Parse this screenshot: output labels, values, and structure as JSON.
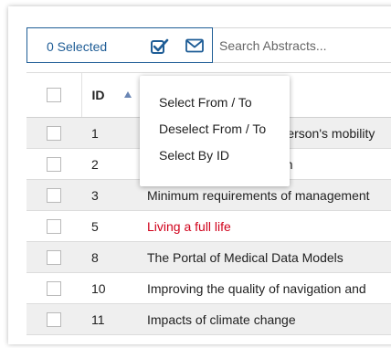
{
  "toolbar": {
    "selected_label": "0 Selected",
    "icons": [
      "checkbox-icon",
      "envelope-icon"
    ],
    "search": {
      "placeholder": "Search Abstracts...",
      "value": ""
    }
  },
  "table": {
    "headers": {
      "select": "",
      "id": "ID",
      "title": ""
    },
    "sort": {
      "column": "ID",
      "direction": "ascending"
    },
    "rows": [
      {
        "id": "1",
        "title": "Impact of a designated person's mobility"
      },
      {
        "id": "2",
        "title": "Patterns of the interaction"
      },
      {
        "id": "3",
        "title": "Minimum requirements of management"
      },
      {
        "id": "5",
        "title": "Living a full life",
        "highlight": true
      },
      {
        "id": "8",
        "title": "The Portal of Medical Data Models"
      },
      {
        "id": "10",
        "title": "Improving the quality of navigation and"
      },
      {
        "id": "11",
        "title": "Impacts of climate change"
      }
    ]
  },
  "dropdown": {
    "items": [
      "Select From / To",
      "Deselect From / To",
      "Select By ID"
    ]
  },
  "colors": {
    "accent": "#1f5d96",
    "highlight_text": "#d0021b",
    "row_stripe": "#efefef"
  }
}
